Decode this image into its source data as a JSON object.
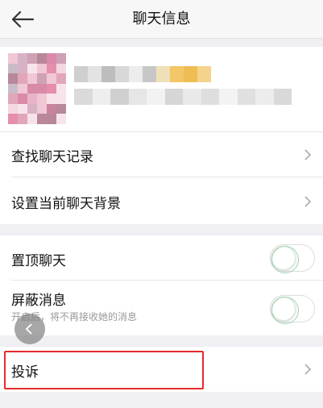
{
  "nav": {
    "title": "聊天信息",
    "back_icon": "arrow-left-icon"
  },
  "profile": {
    "avatar_icon": "blurred-avatar"
  },
  "menu_group_1": {
    "items": [
      {
        "label": "查找聊天记录",
        "icon": "chevron-right-icon"
      },
      {
        "label": "设置当前聊天背景",
        "icon": "chevron-right-icon"
      }
    ]
  },
  "menu_group_2": {
    "items": [
      {
        "label": "置顶聊天",
        "switch_on": false
      },
      {
        "label": "屏蔽消息",
        "sub": "开启后，将不再接收她的消息",
        "switch_on": false
      }
    ]
  },
  "menu_group_3": {
    "items": [
      {
        "label": "投诉",
        "icon": "chevron-right-icon"
      }
    ]
  },
  "colors": {
    "background": "#efeff4",
    "switch_accent": "#9fd3ae",
    "highlight": "#e52b2b"
  }
}
